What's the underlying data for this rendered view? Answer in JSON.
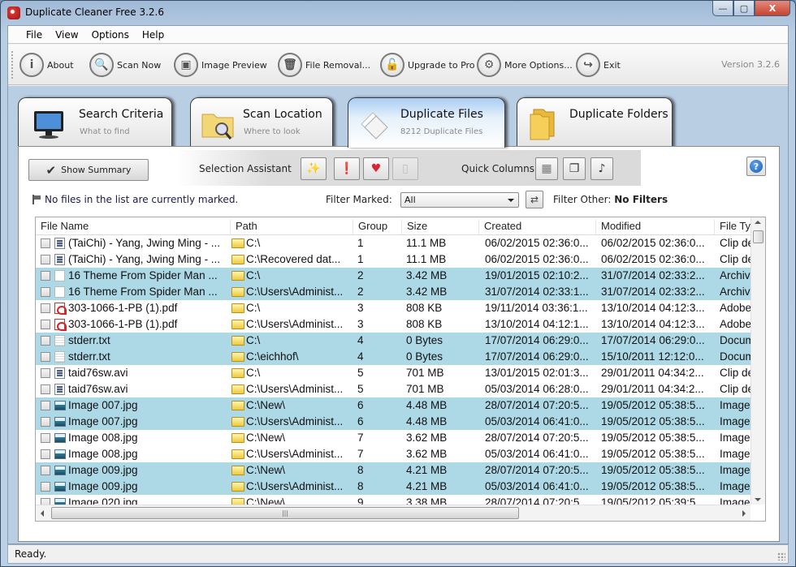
{
  "window": {
    "title": "Duplicate Cleaner Free 3.2.6",
    "controls": {
      "minimize": "—",
      "maximize": "▢",
      "close": "X"
    }
  },
  "menu": [
    "File",
    "View",
    "Options",
    "Help"
  ],
  "toolbar": {
    "buttons": [
      {
        "label": "About",
        "icon": "info-icon",
        "glyph": "i"
      },
      {
        "label": "Scan Now",
        "icon": "magnifier-icon",
        "glyph": "🔍"
      },
      {
        "label": "Image Preview",
        "icon": "image-icon",
        "glyph": "▣"
      },
      {
        "label": "File Removal...",
        "icon": "trash-icon",
        "glyph": "🗑"
      },
      {
        "label": "Upgrade to Pro",
        "icon": "unlock-icon",
        "glyph": "🔓"
      },
      {
        "label": "More Options...",
        "icon": "gear-icon",
        "glyph": "⚙"
      },
      {
        "label": "Exit",
        "icon": "exit-icon",
        "glyph": "↪"
      }
    ],
    "version": "Version 3.2.6"
  },
  "tabs": [
    {
      "title": "Search Criteria",
      "subtitle": "What to find",
      "icon": "monitor-icon",
      "active": false
    },
    {
      "title": "Scan Location",
      "subtitle": "Where to look",
      "icon": "folder-search-icon",
      "active": false
    },
    {
      "title": "Duplicate Files",
      "subtitle": "8212 Duplicate Files",
      "icon": "files-icon",
      "active": true
    },
    {
      "title": "Duplicate Folders",
      "subtitle": "",
      "icon": "folders-icon",
      "active": false
    }
  ],
  "panel": {
    "show_summary": "Show Summary",
    "selection_assistant": "Selection Assistant",
    "selection_buttons": [
      {
        "icon": "magic-wand-icon",
        "glyph": "✨",
        "enabled": true
      },
      {
        "icon": "warning-icon",
        "glyph": "❗",
        "enabled": true
      },
      {
        "icon": "folder-heart-icon",
        "glyph": "♥",
        "enabled": true
      },
      {
        "icon": "document-icon",
        "glyph": "▯",
        "enabled": false
      }
    ],
    "quick_columns": "Quick Columns",
    "quick_column_buttons": [
      {
        "icon": "table-icon",
        "glyph": "▦"
      },
      {
        "icon": "window-icon",
        "glyph": "❐"
      },
      {
        "icon": "music-note-icon",
        "glyph": "♪"
      }
    ],
    "help": "?",
    "marked_message": "No files in the list are currently marked.",
    "filter_marked_label": "Filter Marked:",
    "filter_marked_value": "All",
    "filter_other_label": "Filter Other:",
    "filter_other_value": "No Filters"
  },
  "grid": {
    "columns": [
      "File Name",
      "Path",
      "Group",
      "Size",
      "Created",
      "Modified",
      "File Ty"
    ],
    "rows": [
      {
        "name": "(TaiChi) - Yang, Jwing Ming - ...",
        "type": "video",
        "path": "C:\\",
        "group": "1",
        "size": "11.1 MB",
        "created": "06/02/2015 02:36:0...",
        "modified": "06/02/2015 02:36:0...",
        "filetype": "Clip de",
        "hl": false
      },
      {
        "name": "(TaiChi) - Yang, Jwing Ming - ...",
        "type": "video",
        "path": "C:\\Recovered dat...",
        "group": "1",
        "size": "11.1 MB",
        "created": "06/02/2015 02:36:0...",
        "modified": "06/02/2015 02:36:0...",
        "filetype": "Clip de",
        "hl": false
      },
      {
        "name": "16 Theme From Spider Man ...",
        "type": "blank",
        "path": "C:\\",
        "group": "2",
        "size": "3.42 MB",
        "created": "19/01/2015 02:10:2...",
        "modified": "31/07/2014 02:33:2...",
        "filetype": "Archive",
        "hl": true
      },
      {
        "name": "16 Theme From Spider Man ...",
        "type": "blank",
        "path": "C:\\Users\\Administ...",
        "group": "2",
        "size": "3.42 MB",
        "created": "31/07/2014 02:33:1...",
        "modified": "31/07/2014 02:33:2...",
        "filetype": "Archive",
        "hl": true
      },
      {
        "name": "303-1066-1-PB (1).pdf",
        "type": "pdf",
        "path": "C:\\",
        "group": "3",
        "size": "808 KB",
        "created": "19/11/2014 03:36:1...",
        "modified": "13/10/2014 04:12:3...",
        "filetype": "Adobe",
        "hl": false
      },
      {
        "name": "303-1066-1-PB (1).pdf",
        "type": "pdf",
        "path": "C:\\Users\\Administ...",
        "group": "3",
        "size": "808 KB",
        "created": "13/10/2014 04:12:1...",
        "modified": "13/10/2014 04:12:3...",
        "filetype": "Adobe",
        "hl": false
      },
      {
        "name": "stderr.txt",
        "type": "txt",
        "path": "C:\\",
        "group": "4",
        "size": "0 Bytes",
        "created": "17/07/2014 06:29:0...",
        "modified": "17/07/2014 06:29:0...",
        "filetype": "Docum",
        "hl": true
      },
      {
        "name": "stderr.txt",
        "type": "txt",
        "path": "C:\\eichhof\\",
        "group": "4",
        "size": "0 Bytes",
        "created": "17/07/2014 06:29:0...",
        "modified": "15/10/2011 12:12:0...",
        "filetype": "Docum",
        "hl": true
      },
      {
        "name": "taid76sw.avi",
        "type": "video",
        "path": "C:\\",
        "group": "5",
        "size": "701 MB",
        "created": "13/01/2015 02:01:3...",
        "modified": "29/01/2011 04:34:2...",
        "filetype": "Clip de",
        "hl": false
      },
      {
        "name": "taid76sw.avi",
        "type": "video",
        "path": "C:\\Users\\Administ...",
        "group": "5",
        "size": "701 MB",
        "created": "05/03/2014 06:28:0...",
        "modified": "29/01/2011 04:34:2...",
        "filetype": "Clip de",
        "hl": false
      },
      {
        "name": "Image 007.jpg",
        "type": "img",
        "path": "C:\\New\\",
        "group": "6",
        "size": "4.48 MB",
        "created": "28/07/2014 07:20:5...",
        "modified": "19/05/2012 05:38:5...",
        "filetype": "Imagen",
        "hl": true
      },
      {
        "name": "Image 007.jpg",
        "type": "img",
        "path": "C:\\Users\\Administ...",
        "group": "6",
        "size": "4.48 MB",
        "created": "05/03/2014 06:41:0...",
        "modified": "19/05/2012 05:38:5...",
        "filetype": "Imagen",
        "hl": true
      },
      {
        "name": "Image 008.jpg",
        "type": "img",
        "path": "C:\\New\\",
        "group": "7",
        "size": "3.62 MB",
        "created": "28/07/2014 07:20:5...",
        "modified": "19/05/2012 05:38:5...",
        "filetype": "Imagen",
        "hl": false
      },
      {
        "name": "Image 008.jpg",
        "type": "img",
        "path": "C:\\Users\\Administ...",
        "group": "7",
        "size": "3.62 MB",
        "created": "05/03/2014 06:41:0...",
        "modified": "19/05/2012 05:38:5...",
        "filetype": "Imagen",
        "hl": false
      },
      {
        "name": "Image 009.jpg",
        "type": "img",
        "path": "C:\\New\\",
        "group": "8",
        "size": "4.21 MB",
        "created": "28/07/2014 07:20:5...",
        "modified": "19/05/2012 05:38:5...",
        "filetype": "Imagen",
        "hl": true
      },
      {
        "name": "Image 009.jpg",
        "type": "img",
        "path": "C:\\Users\\Administ...",
        "group": "8",
        "size": "4.21 MB",
        "created": "05/03/2014 06:41:0...",
        "modified": "19/05/2012 05:38:5...",
        "filetype": "Imagen",
        "hl": true
      },
      {
        "name": "Image 020.jpg",
        "type": "img",
        "path": "C:\\New\\",
        "group": "9",
        "size": "3.38 MB",
        "created": "28/07/2014 07:20:5...",
        "modified": "19/05/2012 05:39:5...",
        "filetype": "Imagen",
        "hl": false
      }
    ]
  },
  "status": "Ready.",
  "colors": {
    "row_highlight": "#add8e6",
    "active_tab_top": "#a9cdf2",
    "frame": "#b9cde3"
  }
}
